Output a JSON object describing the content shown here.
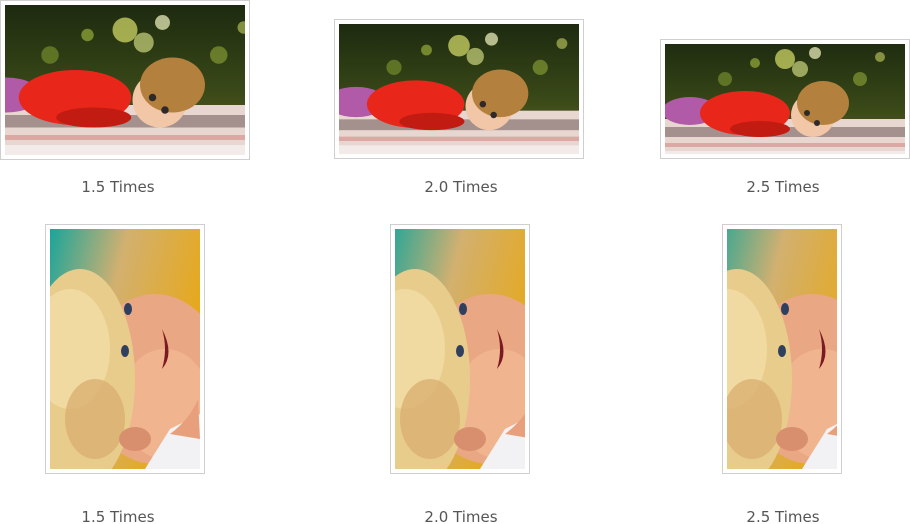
{
  "landscape_row": {
    "items": [
      {
        "caption": "1.5 Times",
        "image": "child-lying-on-table-photo"
      },
      {
        "caption": "2.0 Times",
        "image": "child-lying-on-table-photo"
      },
      {
        "caption": "2.5 Times",
        "image": "child-lying-on-table-photo"
      }
    ]
  },
  "portrait_row": {
    "items": [
      {
        "caption": "1.5 Times",
        "image": "smiling-blond-child-closeup-photo"
      },
      {
        "caption": "2.0 Times",
        "image": "smiling-blond-child-closeup-photo"
      },
      {
        "caption": "2.5 Times",
        "image": "smiling-blond-child-closeup-photo"
      }
    ]
  },
  "colors": {
    "frame_border": "#cfcfcf",
    "caption_text": "#555555",
    "background": "#ffffff"
  }
}
